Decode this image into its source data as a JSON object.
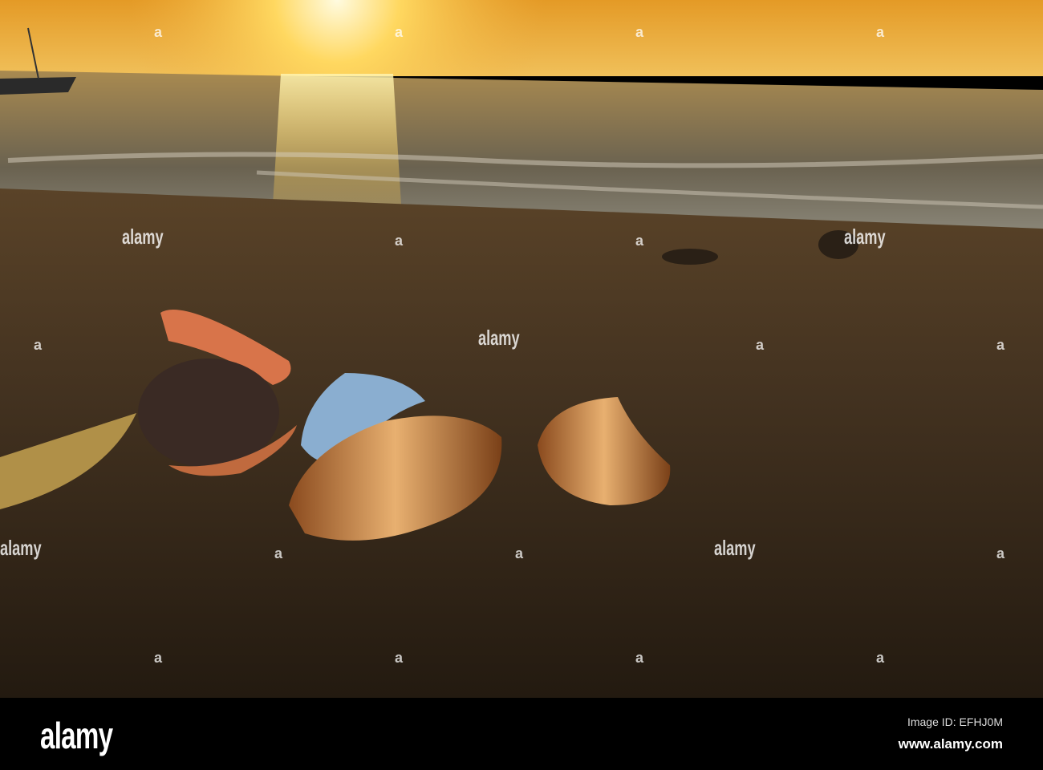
{
  "watermark": {
    "logo": "alamy",
    "small": "a"
  },
  "footer": {
    "logo": "alamy",
    "image_id": "Image ID: EFHJ0M",
    "site": "www.alamy.com"
  },
  "colors": {
    "sky": "#e9a530",
    "sand": "#3a2c1c",
    "sun": "#fff6c0"
  }
}
